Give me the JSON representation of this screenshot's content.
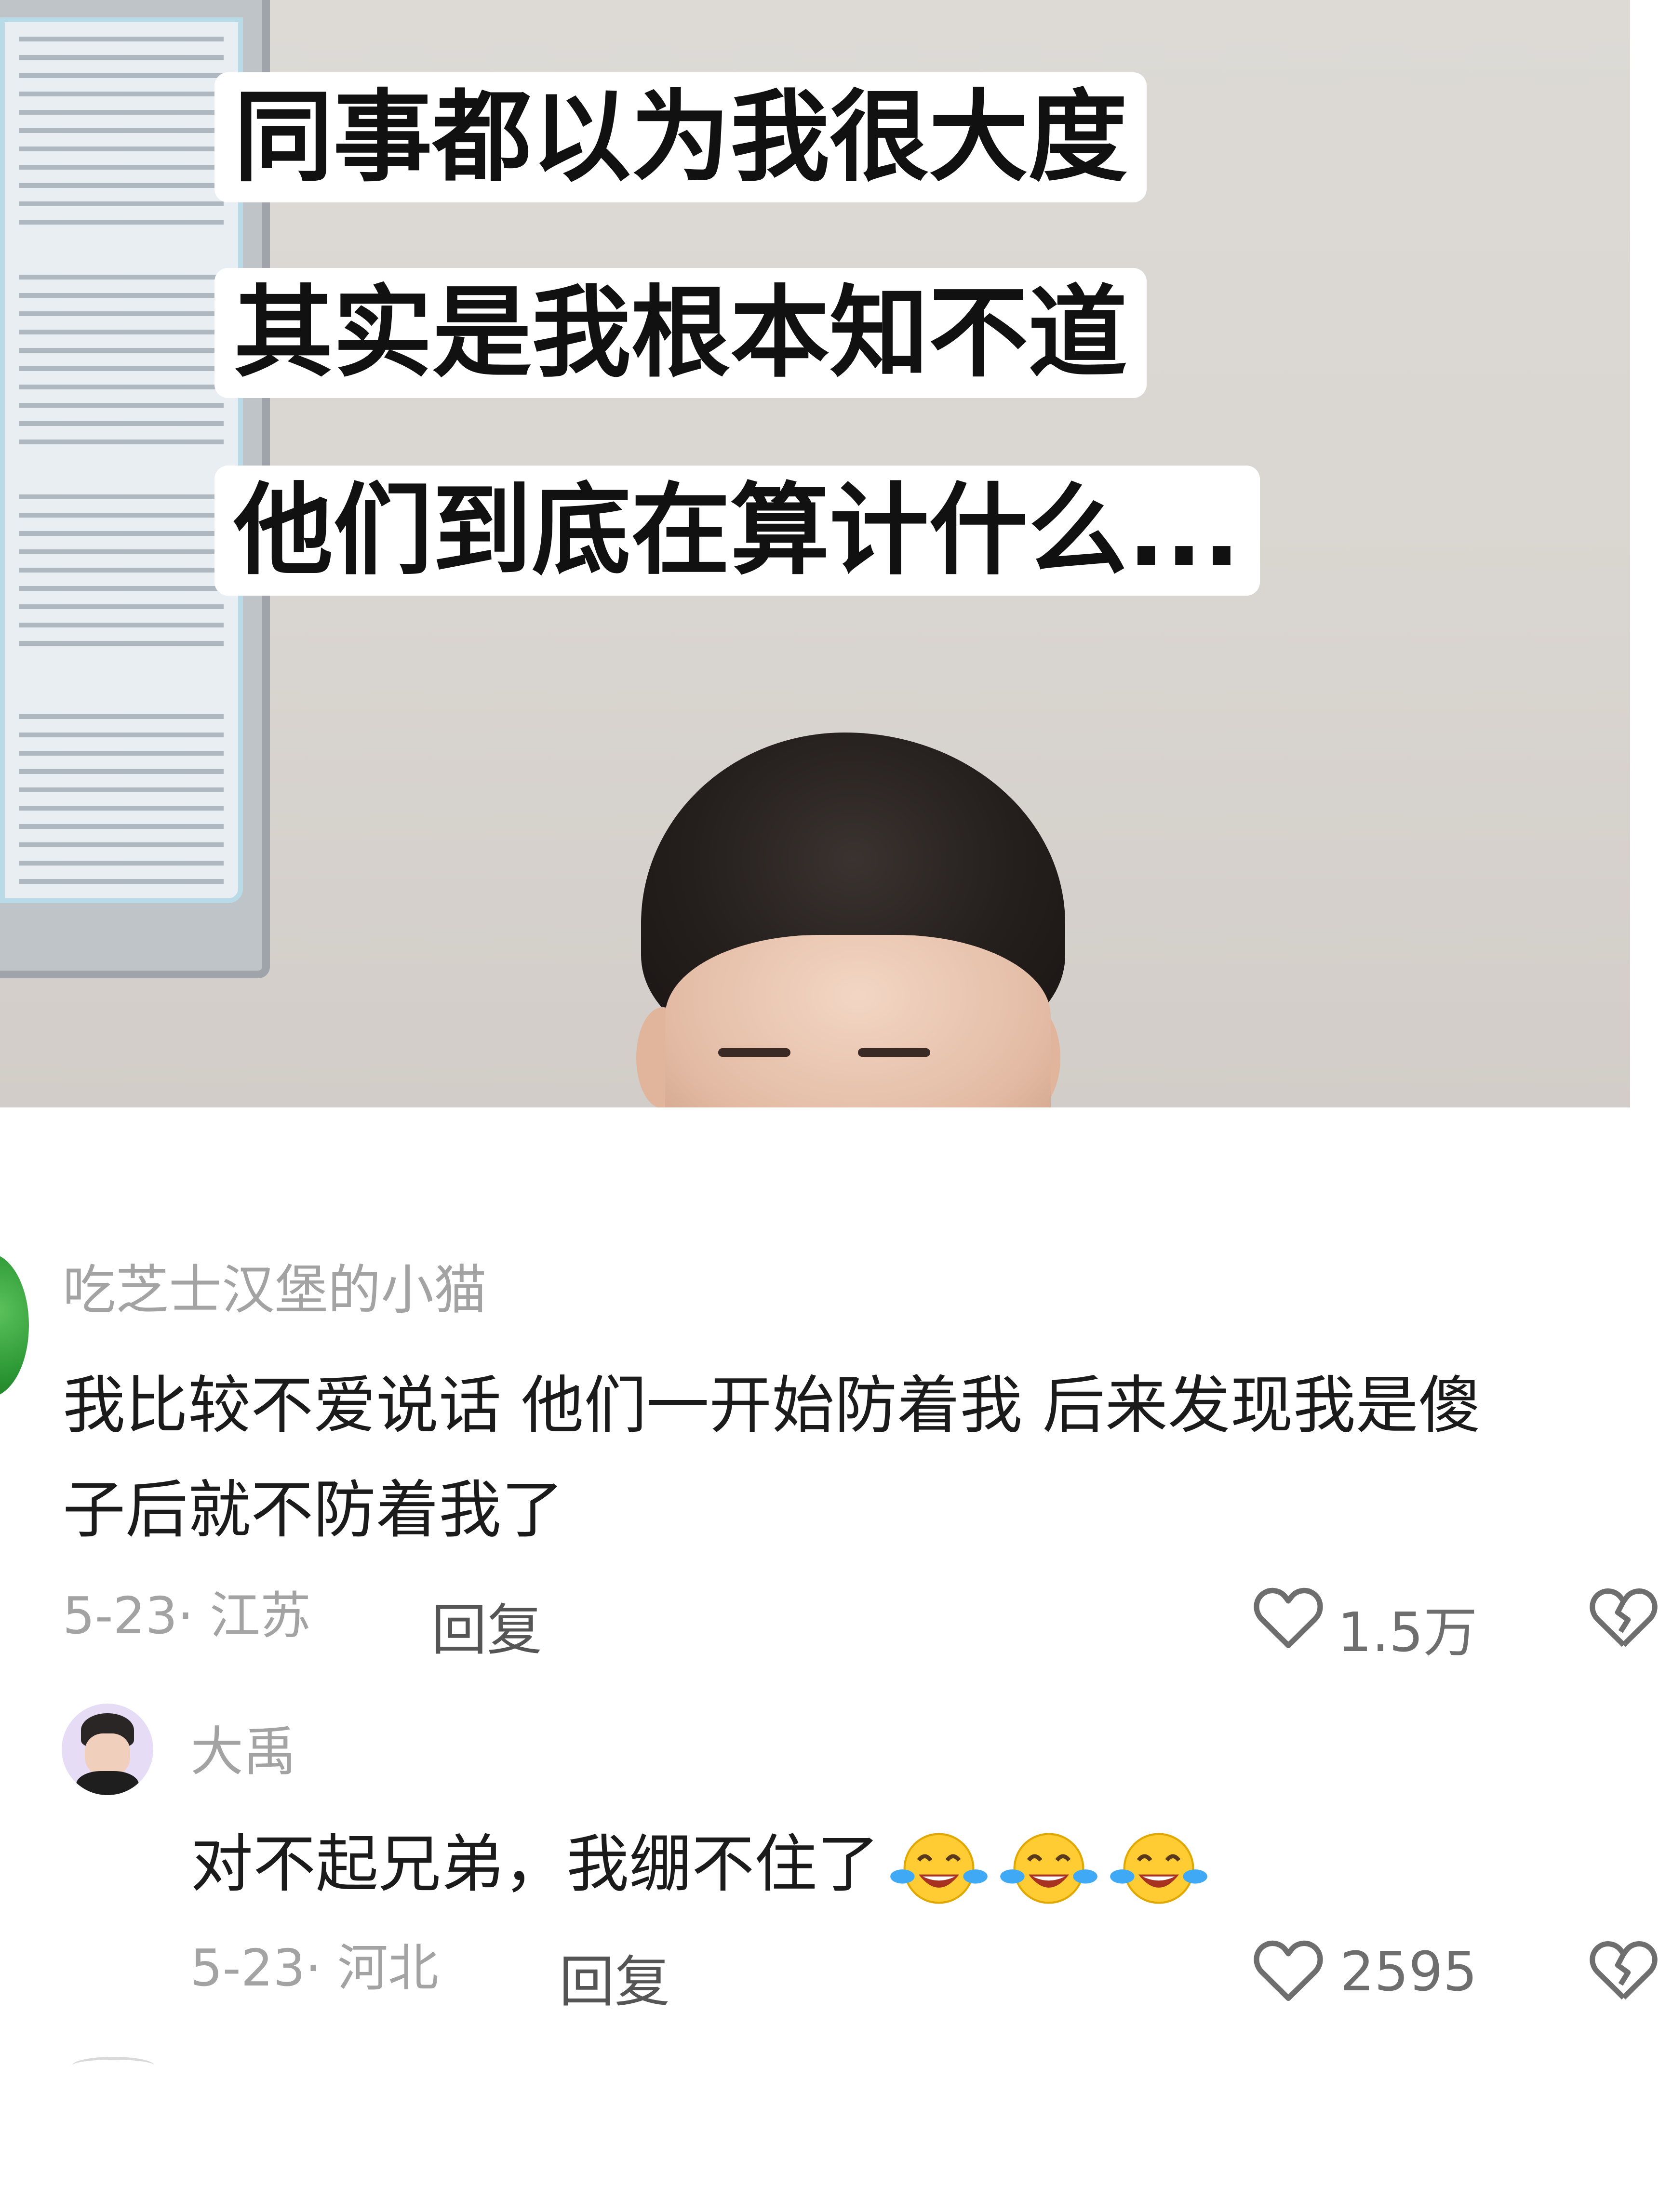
{
  "video": {
    "caption_lines": [
      "同事都以为我很大度",
      "其实是我根本知不道",
      "他们到底在算计什么..."
    ]
  },
  "comments": [
    {
      "username": "吃芝士汉堡的小猫",
      "text_line1": "我比较不爱说话 他们一开始防着我 后来发现我是傻",
      "text_line2": "子后就不防着我了",
      "date_location": "5-23· 江苏",
      "reply_label": "回复",
      "like_count": "1.5万"
    },
    {
      "username": "大禹",
      "text": "对不起兄弟，我绷不住了",
      "emojis": [
        "joy-emoji",
        "joy-emoji",
        "joy-emoji"
      ],
      "date_location": "5-23· 河北",
      "reply_label": "回复",
      "like_count": "2595"
    }
  ],
  "colors": {
    "caption_bg": "#ffffff",
    "caption_text": "#111111",
    "meta_gray": "#a3a3a3",
    "body_text": "#1b1b1b",
    "icon_gray": "#6e6e6e"
  }
}
